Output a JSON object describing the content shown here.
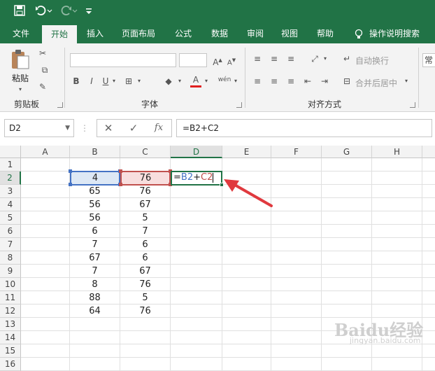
{
  "quick_access": {
    "save_icon": "save-icon",
    "undo_icon": "undo-icon",
    "redo_icon": "redo-icon",
    "customize_icon": "customize-icon"
  },
  "tabs": [
    {
      "label": "文件",
      "active": false
    },
    {
      "label": "开始",
      "active": true
    },
    {
      "label": "插入",
      "active": false
    },
    {
      "label": "页面布局",
      "active": false
    },
    {
      "label": "公式",
      "active": false
    },
    {
      "label": "数据",
      "active": false
    },
    {
      "label": "审阅",
      "active": false
    },
    {
      "label": "视图",
      "active": false
    },
    {
      "label": "帮助",
      "active": false
    }
  ],
  "tell_me": "操作说明搜索",
  "ribbon": {
    "paste_label": "粘贴",
    "clipboard_label": "剪贴板",
    "font_label": "字体",
    "alignment_label": "对齐方式",
    "wrap_text": "自动换行",
    "merge_center": "合并后居中",
    "number_format_partial": "常",
    "bold": "B",
    "italic": "I",
    "underline": "U",
    "phonetic": "wén",
    "font_color_letter": "A"
  },
  "formula_bar": {
    "name_box": "D2",
    "cancel": "✕",
    "enter": "✓",
    "fx": "fx",
    "formula": "=B2+C2"
  },
  "columns": [
    "A",
    "B",
    "C",
    "D",
    "E",
    "F",
    "G",
    "H"
  ],
  "rows": [
    "1",
    "2",
    "3",
    "4",
    "5",
    "6",
    "7",
    "8",
    "9",
    "10",
    "11",
    "12",
    "13",
    "14",
    "15",
    "16"
  ],
  "selected_cell": {
    "col": "D",
    "row": "2"
  },
  "data_b": [
    "4",
    "65",
    "56",
    "56",
    "6",
    "7",
    "67",
    "7",
    "8",
    "88",
    "64"
  ],
  "data_c": [
    "76",
    "76",
    "67",
    "5",
    "7",
    "6",
    "6",
    "67",
    "76",
    "5",
    "76"
  ],
  "editing": {
    "eq": "=",
    "ref1": "B2",
    "plus": "+",
    "ref2": "C2"
  },
  "colors": {
    "excel_green": "#217346",
    "ref_blue": "#4472c4",
    "ref_red": "#c0504d",
    "arrow_red": "#e0393e"
  },
  "watermark": {
    "brand": "Baidu经验",
    "url": "jingyan.baidu.com"
  }
}
